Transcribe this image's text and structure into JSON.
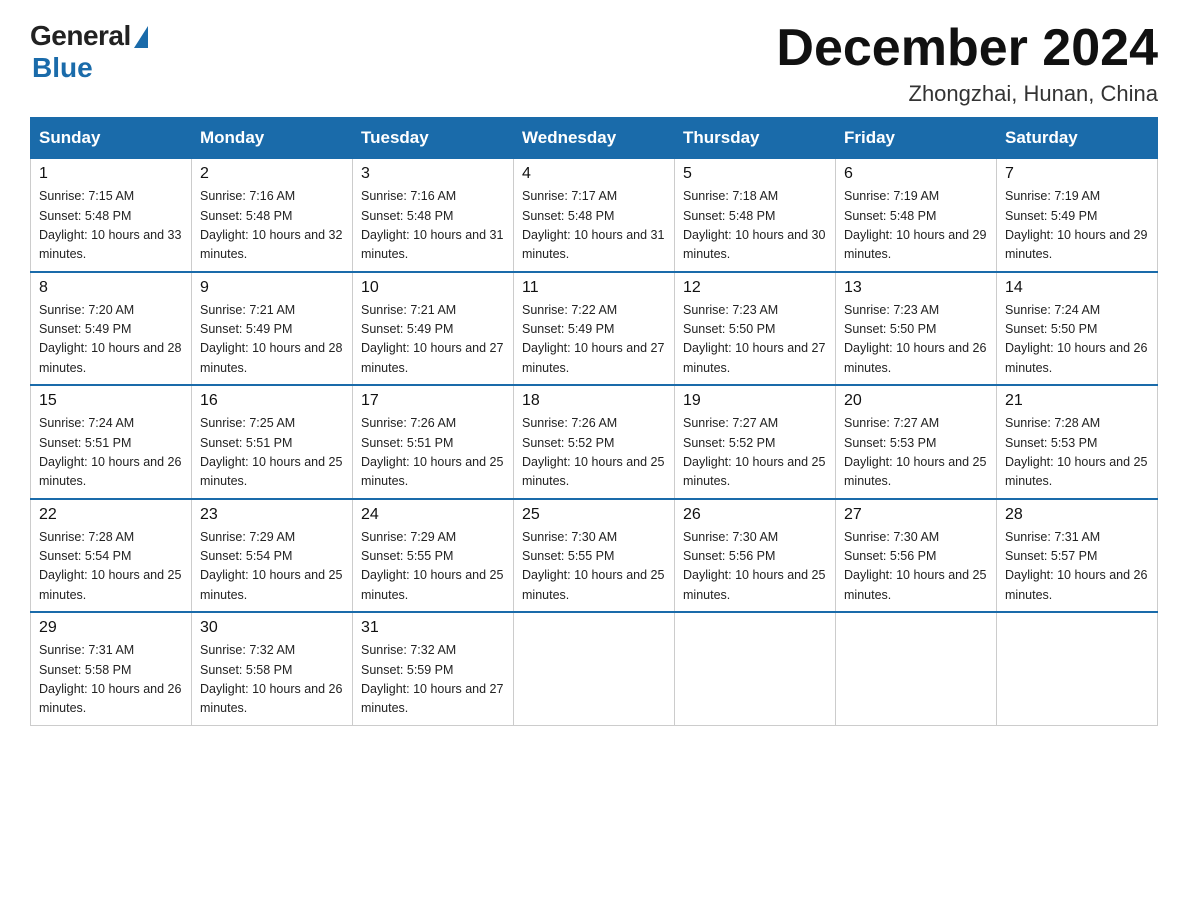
{
  "logo": {
    "general_text": "General",
    "blue_text": "Blue"
  },
  "title": {
    "month_year": "December 2024",
    "location": "Zhongzhai, Hunan, China"
  },
  "headers": [
    "Sunday",
    "Monday",
    "Tuesday",
    "Wednesday",
    "Thursday",
    "Friday",
    "Saturday"
  ],
  "weeks": [
    [
      {
        "day": "1",
        "sunrise": "7:15 AM",
        "sunset": "5:48 PM",
        "daylight": "10 hours and 33 minutes."
      },
      {
        "day": "2",
        "sunrise": "7:16 AM",
        "sunset": "5:48 PM",
        "daylight": "10 hours and 32 minutes."
      },
      {
        "day": "3",
        "sunrise": "7:16 AM",
        "sunset": "5:48 PM",
        "daylight": "10 hours and 31 minutes."
      },
      {
        "day": "4",
        "sunrise": "7:17 AM",
        "sunset": "5:48 PM",
        "daylight": "10 hours and 31 minutes."
      },
      {
        "day": "5",
        "sunrise": "7:18 AM",
        "sunset": "5:48 PM",
        "daylight": "10 hours and 30 minutes."
      },
      {
        "day": "6",
        "sunrise": "7:19 AM",
        "sunset": "5:48 PM",
        "daylight": "10 hours and 29 minutes."
      },
      {
        "day": "7",
        "sunrise": "7:19 AM",
        "sunset": "5:49 PM",
        "daylight": "10 hours and 29 minutes."
      }
    ],
    [
      {
        "day": "8",
        "sunrise": "7:20 AM",
        "sunset": "5:49 PM",
        "daylight": "10 hours and 28 minutes."
      },
      {
        "day": "9",
        "sunrise": "7:21 AM",
        "sunset": "5:49 PM",
        "daylight": "10 hours and 28 minutes."
      },
      {
        "day": "10",
        "sunrise": "7:21 AM",
        "sunset": "5:49 PM",
        "daylight": "10 hours and 27 minutes."
      },
      {
        "day": "11",
        "sunrise": "7:22 AM",
        "sunset": "5:49 PM",
        "daylight": "10 hours and 27 minutes."
      },
      {
        "day": "12",
        "sunrise": "7:23 AM",
        "sunset": "5:50 PM",
        "daylight": "10 hours and 27 minutes."
      },
      {
        "day": "13",
        "sunrise": "7:23 AM",
        "sunset": "5:50 PM",
        "daylight": "10 hours and 26 minutes."
      },
      {
        "day": "14",
        "sunrise": "7:24 AM",
        "sunset": "5:50 PM",
        "daylight": "10 hours and 26 minutes."
      }
    ],
    [
      {
        "day": "15",
        "sunrise": "7:24 AM",
        "sunset": "5:51 PM",
        "daylight": "10 hours and 26 minutes."
      },
      {
        "day": "16",
        "sunrise": "7:25 AM",
        "sunset": "5:51 PM",
        "daylight": "10 hours and 25 minutes."
      },
      {
        "day": "17",
        "sunrise": "7:26 AM",
        "sunset": "5:51 PM",
        "daylight": "10 hours and 25 minutes."
      },
      {
        "day": "18",
        "sunrise": "7:26 AM",
        "sunset": "5:52 PM",
        "daylight": "10 hours and 25 minutes."
      },
      {
        "day": "19",
        "sunrise": "7:27 AM",
        "sunset": "5:52 PM",
        "daylight": "10 hours and 25 minutes."
      },
      {
        "day": "20",
        "sunrise": "7:27 AM",
        "sunset": "5:53 PM",
        "daylight": "10 hours and 25 minutes."
      },
      {
        "day": "21",
        "sunrise": "7:28 AM",
        "sunset": "5:53 PM",
        "daylight": "10 hours and 25 minutes."
      }
    ],
    [
      {
        "day": "22",
        "sunrise": "7:28 AM",
        "sunset": "5:54 PM",
        "daylight": "10 hours and 25 minutes."
      },
      {
        "day": "23",
        "sunrise": "7:29 AM",
        "sunset": "5:54 PM",
        "daylight": "10 hours and 25 minutes."
      },
      {
        "day": "24",
        "sunrise": "7:29 AM",
        "sunset": "5:55 PM",
        "daylight": "10 hours and 25 minutes."
      },
      {
        "day": "25",
        "sunrise": "7:30 AM",
        "sunset": "5:55 PM",
        "daylight": "10 hours and 25 minutes."
      },
      {
        "day": "26",
        "sunrise": "7:30 AM",
        "sunset": "5:56 PM",
        "daylight": "10 hours and 25 minutes."
      },
      {
        "day": "27",
        "sunrise": "7:30 AM",
        "sunset": "5:56 PM",
        "daylight": "10 hours and 25 minutes."
      },
      {
        "day": "28",
        "sunrise": "7:31 AM",
        "sunset": "5:57 PM",
        "daylight": "10 hours and 26 minutes."
      }
    ],
    [
      {
        "day": "29",
        "sunrise": "7:31 AM",
        "sunset": "5:58 PM",
        "daylight": "10 hours and 26 minutes."
      },
      {
        "day": "30",
        "sunrise": "7:32 AM",
        "sunset": "5:58 PM",
        "daylight": "10 hours and 26 minutes."
      },
      {
        "day": "31",
        "sunrise": "7:32 AM",
        "sunset": "5:59 PM",
        "daylight": "10 hours and 27 minutes."
      },
      null,
      null,
      null,
      null
    ]
  ],
  "labels": {
    "sunrise_prefix": "Sunrise: ",
    "sunset_prefix": "Sunset: ",
    "daylight_prefix": "Daylight: "
  }
}
